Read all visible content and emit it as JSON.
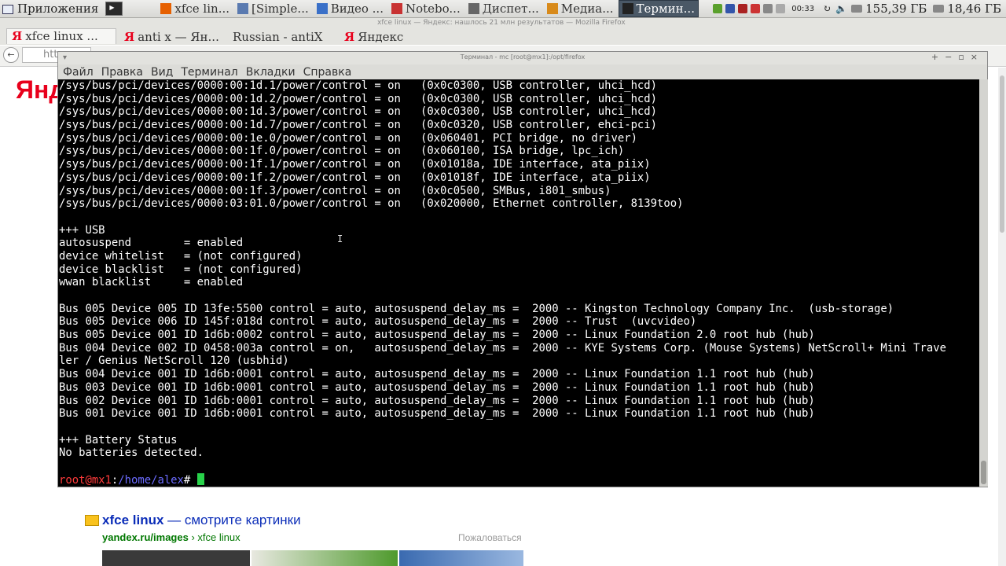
{
  "panel": {
    "apps_label": "Приложения",
    "tasks": [
      {
        "label": "xfce lin...",
        "icon_color": "#e66000",
        "active": false
      },
      {
        "label": "[Simple...",
        "icon_color": "#5a7ab0",
        "active": false
      },
      {
        "label": "Видео ...",
        "icon_color": "#3a70c8",
        "active": false
      },
      {
        "label": "Notebo...",
        "icon_color": "#c83232",
        "active": false
      },
      {
        "label": "Диспет...",
        "icon_color": "#666666",
        "active": false
      },
      {
        "label": "Медиа...",
        "icon_color": "#d88a1a",
        "active": false
      },
      {
        "label": "Термин...",
        "icon_color": "#222222",
        "active": true
      }
    ],
    "clock": "00:33",
    "disk1": "155,39 ГБ",
    "disk2": "18,46 ГБ"
  },
  "browser": {
    "window_title": "xfce linux — Яндекс: нашлось 21 млн результатов — Mozilla Firefox",
    "tabs": [
      {
        "label": "xfce linux ..."
      },
      {
        "label": "anti x — Ян..."
      },
      {
        "label": "Russian - antiX"
      },
      {
        "label": "Яндекс"
      }
    ],
    "url_prefix": "htt",
    "logo_text": "Янде",
    "result": {
      "title_bold": "xfce linux",
      "title_rest": " — смотрите картинки",
      "url_bold": "yandex.ru/images",
      "url_rest": " › xfce linux",
      "complain": "Пожаловаться"
    }
  },
  "terminal": {
    "title": "Терминал - mc [root@mx1]:/opt/firefox",
    "menu": [
      "Файл",
      "Правка",
      "Вид",
      "Терминал",
      "Вкладки",
      "Справка"
    ],
    "lines": [
      "/sys/bus/pci/devices/0000:00:1d.1/power/control = on   (0x0c0300, USB controller, uhci_hcd)",
      "/sys/bus/pci/devices/0000:00:1d.2/power/control = on   (0x0c0300, USB controller, uhci_hcd)",
      "/sys/bus/pci/devices/0000:00:1d.3/power/control = on   (0x0c0300, USB controller, uhci_hcd)",
      "/sys/bus/pci/devices/0000:00:1d.7/power/control = on   (0x0c0320, USB controller, ehci-pci)",
      "/sys/bus/pci/devices/0000:00:1e.0/power/control = on   (0x060401, PCI bridge, no driver)",
      "/sys/bus/pci/devices/0000:00:1f.0/power/control = on   (0x060100, ISA bridge, lpc_ich)",
      "/sys/bus/pci/devices/0000:00:1f.1/power/control = on   (0x01018a, IDE interface, ata_piix)",
      "/sys/bus/pci/devices/0000:00:1f.2/power/control = on   (0x01018f, IDE interface, ata_piix)",
      "/sys/bus/pci/devices/0000:00:1f.3/power/control = on   (0x0c0500, SMBus, i801_smbus)",
      "/sys/bus/pci/devices/0000:03:01.0/power/control = on   (0x020000, Ethernet controller, 8139too)",
      "",
      "+++ USB",
      "autosuspend        = enabled",
      "device whitelist   = (not configured)",
      "device blacklist   = (not configured)",
      "wwan blacklist     = enabled",
      "",
      "Bus 005 Device 005 ID 13fe:5500 control = auto, autosuspend_delay_ms =  2000 -- Kingston Technology Company Inc.  (usb-storage)",
      "Bus 005 Device 006 ID 145f:018d control = auto, autosuspend_delay_ms =  2000 -- Trust  (uvcvideo)",
      "Bus 005 Device 001 ID 1d6b:0002 control = auto, autosuspend_delay_ms =  2000 -- Linux Foundation 2.0 root hub (hub)",
      "Bus 004 Device 002 ID 0458:003a control = on,   autosuspend_delay_ms =  2000 -- KYE Systems Corp. (Mouse Systems) NetScroll+ Mini Trave",
      "ler / Genius NetScroll 120 (usbhid)",
      "Bus 004 Device 001 ID 1d6b:0001 control = auto, autosuspend_delay_ms =  2000 -- Linux Foundation 1.1 root hub (hub)",
      "Bus 003 Device 001 ID 1d6b:0001 control = auto, autosuspend_delay_ms =  2000 -- Linux Foundation 1.1 root hub (hub)",
      "Bus 002 Device 001 ID 1d6b:0001 control = auto, autosuspend_delay_ms =  2000 -- Linux Foundation 1.1 root hub (hub)",
      "Bus 001 Device 001 ID 1d6b:0001 control = auto, autosuspend_delay_ms =  2000 -- Linux Foundation 1.1 root hub (hub)",
      "",
      "+++ Battery Status",
      "No batteries detected.",
      ""
    ],
    "prompt_user": "root@mx1",
    "prompt_sep": ":",
    "prompt_path": "/home/alex",
    "prompt_char": "# ",
    "colors": {
      "user": "#ff3b3b",
      "path": "#6b6bff",
      "cursor": "#28d24a"
    }
  }
}
